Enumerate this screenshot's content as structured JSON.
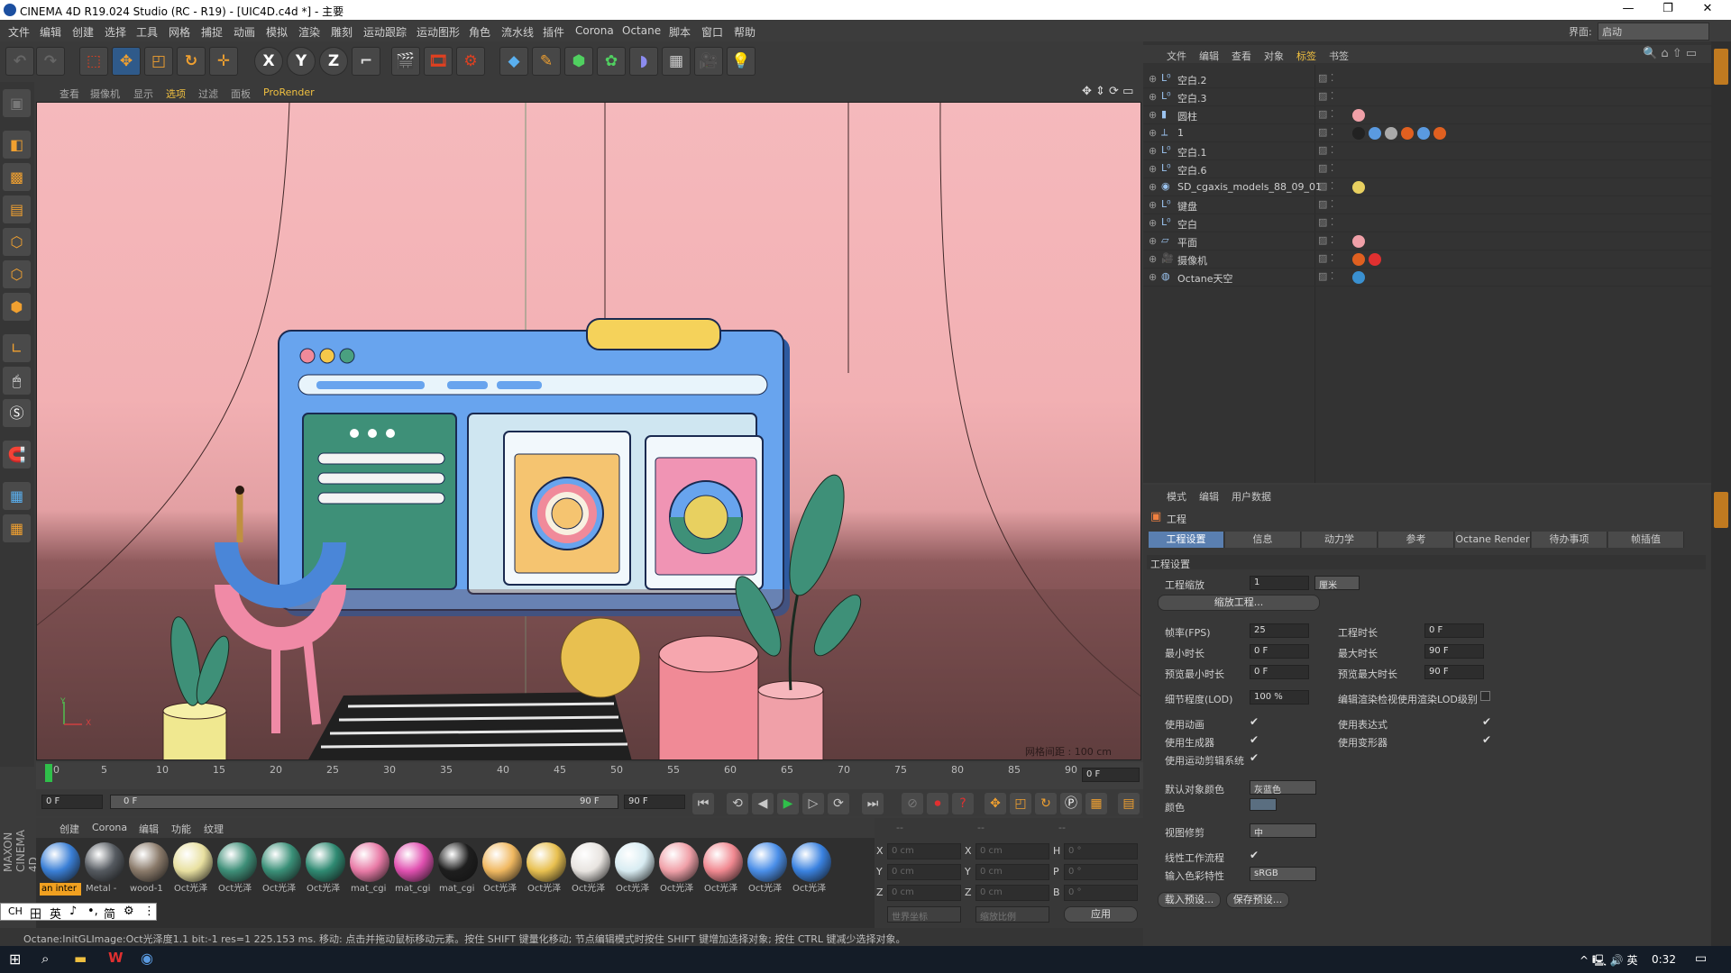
{
  "window": {
    "title": "CINEMA 4D R19.024 Studio (RC - R19) - [UIC4D.c4d *] - 主要",
    "min": "—",
    "max": "❐",
    "close": "✕"
  },
  "menu": [
    "文件",
    "编辑",
    "创建",
    "选择",
    "工具",
    "网格",
    "捕捉",
    "动画",
    "模拟",
    "渲染",
    "雕刻",
    "运动跟踪",
    "运动图形",
    "角色",
    "流水线",
    "插件",
    "Corona",
    "Octane",
    "脚本",
    "窗口",
    "帮助"
  ],
  "layout": {
    "label": "界面:",
    "value": "启动"
  },
  "toolbar": {
    "x": "X",
    "y": "Y",
    "z": "Z"
  },
  "viewport": {
    "menu": [
      "查看",
      "摄像机",
      "显示",
      "选项",
      "过滤",
      "面板",
      "ProRender"
    ],
    "grid_label": "网格间距 : 100 cm",
    "axis_y": "Y",
    "axis_x": "X"
  },
  "timeline": {
    "ticks": [
      "0",
      "5",
      "10",
      "15",
      "20",
      "25",
      "30",
      "35",
      "40",
      "45",
      "50",
      "55",
      "60",
      "65",
      "70",
      "75",
      "80",
      "85",
      "90"
    ],
    "current": "0 F",
    "start": "0 F",
    "range_start": "0 F",
    "range_end": "90 F",
    "end": "90 F"
  },
  "materials": {
    "menu": [
      "创建",
      "Corona",
      "编辑",
      "功能",
      "纹理"
    ],
    "items": [
      {
        "label": "an inter",
        "color": "#3a7fd6"
      },
      {
        "label": "Metal -",
        "color": "#555a60"
      },
      {
        "label": "wood-1",
        "color": "#8a7a6a"
      },
      {
        "label": "Oct光泽",
        "color": "#e8e0a0"
      },
      {
        "label": "Oct光泽",
        "color": "#3e8f78"
      },
      {
        "label": "Oct光泽",
        "color": "#3a9078"
      },
      {
        "label": "Oct光泽",
        "color": "#2f8a72"
      },
      {
        "label": "mat_cgi",
        "color": "#e87aa6"
      },
      {
        "label": "mat_cgi",
        "color": "#e050b0"
      },
      {
        "label": "mat_cgi",
        "color": "#1e1e1e"
      },
      {
        "label": "Oct光泽",
        "color": "#f0b860"
      },
      {
        "label": "Oct光泽",
        "color": "#e8c050"
      },
      {
        "label": "Oct光泽",
        "color": "#e8e4e0"
      },
      {
        "label": "Oct光泽",
        "color": "#d8ecf2"
      },
      {
        "label": "Oct光泽",
        "color": "#f0a0a8"
      },
      {
        "label": "Oct光泽",
        "color": "#f08890"
      },
      {
        "label": "Oct光泽",
        "color": "#4a8ee8"
      },
      {
        "label": "Oct光泽",
        "color": "#3a82e0"
      }
    ]
  },
  "coords": {
    "x": "X",
    "y": "Y",
    "z": "Z",
    "h": "H",
    "p": "P",
    "b": "B",
    "val_cm": "0 cm",
    "val_deg": "0 °",
    "dash": "--",
    "world": "世界坐标",
    "scale": "缩放比例",
    "apply": "应用"
  },
  "ime": [
    "CH",
    "田",
    "英",
    "♪",
    "•,",
    "简",
    "⚙",
    "⋮"
  ],
  "status": "Octane:InitGLImage:Oct光泽度1.1  bit:-1 res=1  225.153 ms.       移动: 点击并拖动鼠标移动元素。按住 SHIFT 键量化移动; 节点编辑模式时按住 SHIFT 键增加选择对象; 按住 CTRL 键减少选择对象。",
  "objects": {
    "menu": [
      "文件",
      "编辑",
      "查看",
      "对象",
      "标签",
      "书签"
    ],
    "rows": [
      "空白.2",
      "空白.3",
      "圆柱",
      "1",
      "空白.1",
      "空白.6",
      "SD_cgaxis_models_88_09_01",
      "键盘",
      "空白",
      "平面",
      "摄像机",
      "Octane天空"
    ]
  },
  "attributes": {
    "menu": [
      "模式",
      "编辑",
      "用户数据"
    ],
    "heading": "工程",
    "tabs": [
      "工程设置",
      "信息",
      "动力学",
      "参考",
      "Octane Render",
      "待办事项",
      "帧插值"
    ],
    "section": "工程设置",
    "scale_label": "工程缩放",
    "scale_val": "1",
    "unit": "厘米",
    "scale_btn": "缩放工程...",
    "fps_label": "帧率(FPS)",
    "fps_val": "25",
    "min_time_label": "最小时长",
    "min_time_val": "0 F",
    "preview_min_label": "预览最小时长",
    "preview_min_val": "0 F",
    "proj_time_label": "工程时长",
    "proj_time_val": "0 F",
    "max_time_label": "最大时长",
    "max_time_val": "90 F",
    "preview_max_label": "预览最大时长",
    "preview_max_val": "90 F",
    "lod_label": "细节程度(LOD)",
    "lod_val": "100 %",
    "lod_render_label": "编辑渲染检视使用渲染LOD级别",
    "use_anim": "使用动画",
    "use_gen": "使用生成器",
    "use_motion": "使用运动剪辑系统",
    "use_expr": "使用表达式",
    "use_deform": "使用变形器",
    "default_color_label": "默认对象颜色",
    "default_color_val": "灰蓝色",
    "color_label": "颜色",
    "clip_label": "视图修剪",
    "clip_val": "中",
    "linear_label": "线性工作流程",
    "input_color_label": "输入色彩特性",
    "input_color_val": "sRGB",
    "load_preset": "载入预设...",
    "save_preset": "保存预设..."
  },
  "taskbar": {
    "time": "0:32",
    "tray": "^ 🖳 🔊 英"
  }
}
